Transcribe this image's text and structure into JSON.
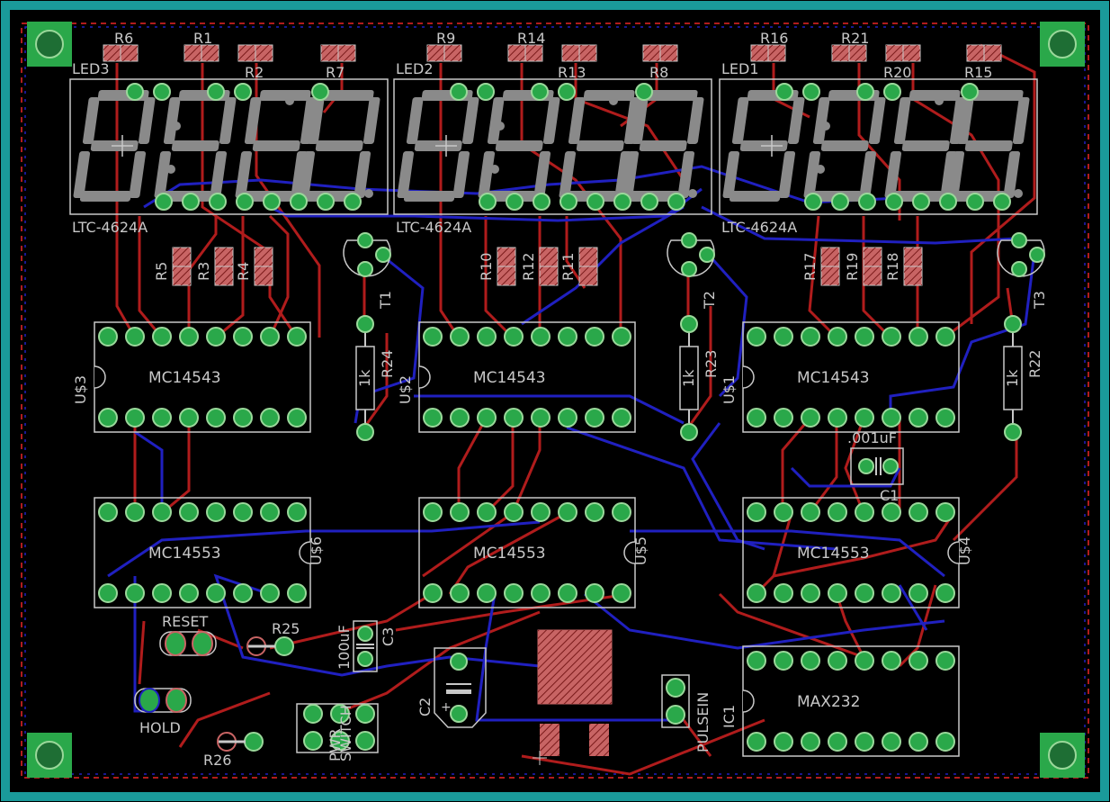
{
  "colors": {
    "background": "#000000",
    "board_outline": "#1a9a9a",
    "silkscreen": "#c8c8c8",
    "pad": "#2aa84a",
    "pad_ring": "#9ad89a",
    "top_trace": "#b01c1c",
    "bottom_trace": "#2020c0",
    "resistor_fill": "#c86464",
    "dashed_border": "#b01c1c",
    "dashed_border_blue": "#2020c0"
  },
  "displays": [
    {
      "ref": "LED3",
      "part": "LTC-4624A"
    },
    {
      "ref": "LED2",
      "part": "LTC-4624A"
    },
    {
      "ref": "LED1",
      "part": "LTC-4624A"
    }
  ],
  "top_resistors": {
    "row1": [
      "R6",
      "R1",
      "R9",
      "R14",
      "R16",
      "R21"
    ],
    "row2": [
      "R2",
      "R7",
      "R13",
      "R8",
      "R20",
      "R15"
    ]
  },
  "mid_resistors": [
    "R5",
    "R3",
    "R4",
    "R10",
    "R12",
    "R11",
    "R17",
    "R19",
    "R18"
  ],
  "transistors": [
    "T1",
    "T2",
    "T3"
  ],
  "base_resistors": [
    {
      "ref": "R24",
      "value": "1k"
    },
    {
      "ref": "R23",
      "value": "1k"
    },
    {
      "ref": "R22",
      "value": "1k"
    }
  ],
  "chips_upper": [
    {
      "ref": "U$3",
      "part": "MC14543"
    },
    {
      "ref": "U$2",
      "part": "MC14543"
    },
    {
      "ref": "U$1",
      "part": "MC14543"
    }
  ],
  "chips_lower": [
    {
      "ref": "U$6",
      "part": "MC14553"
    },
    {
      "ref": "U$5",
      "part": "MC14553"
    },
    {
      "ref": "U$4",
      "part": "MC14553"
    }
  ],
  "max232": {
    "ref": "IC1",
    "part": "MAX232"
  },
  "capacitors": {
    "c1": {
      "ref": "C1",
      "value": ".001uF"
    },
    "c2": {
      "ref": "C2"
    },
    "c3": {
      "ref": "C3",
      "value": "100uF"
    }
  },
  "switches": {
    "reset": "RESET",
    "hold": "HOLD",
    "power": "PWR",
    "power_value": "SWITCH",
    "pulse": "PULSEIN"
  },
  "small_resistors": [
    "R25",
    "R26"
  ]
}
